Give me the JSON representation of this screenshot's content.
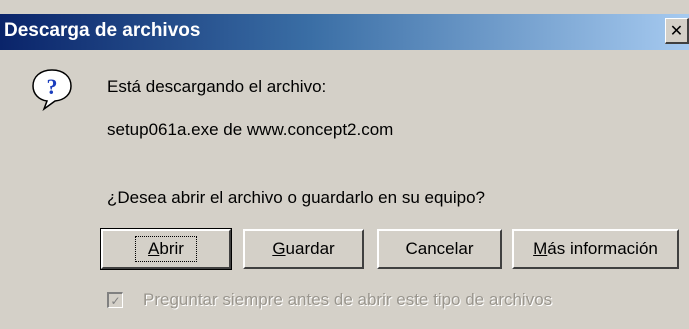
{
  "window": {
    "title": "Descarga de archivos",
    "close_glyph": "✕"
  },
  "icon": {
    "name": "question-icon",
    "color": "#1a3dbd"
  },
  "message": {
    "line1": "Está descargando el archivo:",
    "line2": "setup061a.exe de www.concept2.com",
    "question": "¿Desea abrir el archivo o guardarlo en su equipo?"
  },
  "buttons": {
    "open": {
      "accesskey": "A",
      "rest": "brir"
    },
    "save": {
      "accesskey": "G",
      "rest": "uardar"
    },
    "cancel": {
      "label": "Cancelar"
    },
    "more": {
      "accesskey": "M",
      "rest": "ás información"
    }
  },
  "checkbox": {
    "checked": true,
    "enabled": false,
    "label": "Preguntar siempre antes de abrir este tipo de archivos"
  }
}
